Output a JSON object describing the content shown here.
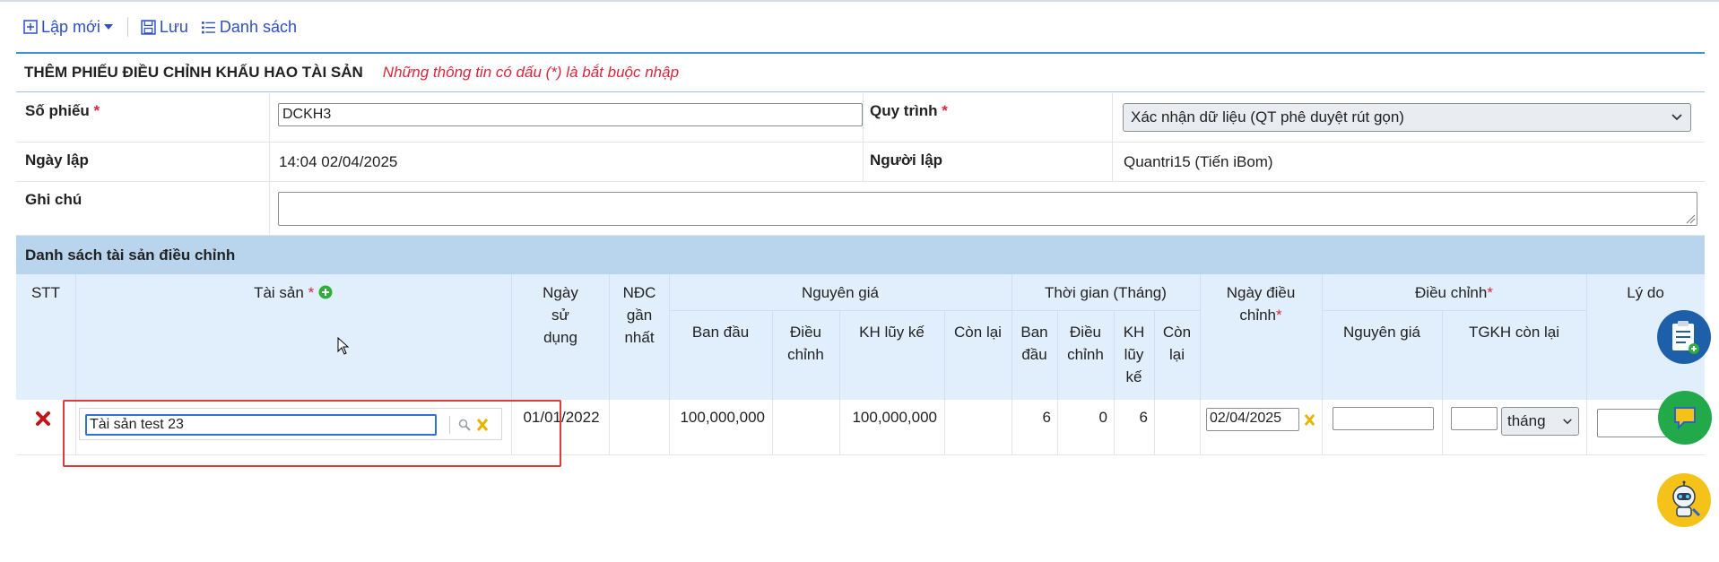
{
  "toolbar": {
    "new_label": "Lập mới",
    "save_label": "Lưu",
    "list_label": "Danh sách"
  },
  "form": {
    "title": "THÊM PHIẾU ĐIỀU CHỈNH KHẤU HAO TÀI SẢN",
    "note": "Những thông tin có dấu (*) là bắt buộc nhập",
    "so_phieu_label": "Số phiếu",
    "so_phieu_value": "DCKH3",
    "quy_trinh_label": "Quy trình",
    "quy_trinh_value": "Xác nhận dữ liệu (QT phê duyệt rút gọn)",
    "ngay_lap_label": "Ngày lập",
    "ngay_lap_value": "14:04 02/04/2025",
    "nguoi_lap_label": "Người lập",
    "nguoi_lap_value": "Quantri15 (Tiến iBom)",
    "ghi_chu_label": "Ghi chú",
    "ghi_chu_value": "",
    "required_mark": "*"
  },
  "list": {
    "title": "Danh sách tài sản điều chỉnh",
    "headers": {
      "stt": "STT",
      "tai_san": "Tài sản",
      "ngay_su_dung": "Ngày sử dụng",
      "ndc_gan_nhat": "NĐC gần nhất",
      "nguyen_gia": "Nguyên giá",
      "ban_dau": "Ban đầu",
      "dieu_chinh": "Điều chỉnh",
      "kh_luy_ke": "KH lũy kế",
      "con_lai": "Còn lại",
      "thoi_gian": "Thời gian (Tháng)",
      "tg_ban_dau": "Ban đầu",
      "tg_dieu_chinh": "Điều chỉnh",
      "tg_kh_luy_ke": "KH lũy kế",
      "tg_con_lai": "Còn lại",
      "ngay_dieu_chinh": "Ngày điều chỉnh",
      "dc_group": "Điều chỉnh",
      "dc_nguyen_gia": "Nguyên giá",
      "dc_tgkh_con_lai": "TGKH còn lại",
      "ly_do": "Lý do"
    },
    "rows": [
      {
        "tai_san": "Tài sản test 23",
        "ngay_su_dung": "01/01/2022",
        "ndc_gan_nhat": "",
        "ng_ban_dau": "100,000,000",
        "ng_dieu_chinh": "",
        "ng_kh_luy_ke": "100,000,000",
        "ng_con_lai": "",
        "tg_ban_dau": "6",
        "tg_dieu_chinh": "0",
        "tg_kh_luy_ke": "6",
        "tg_con_lai": "",
        "ngay_dieu_chinh": "02/04/2025",
        "dc_nguyen_gia": "",
        "dc_tgkh_value": "",
        "dc_tgkh_unit": "tháng",
        "ly_do": ""
      }
    ]
  },
  "colors": {
    "link": "#2d4fc9",
    "required": "#d7263d",
    "accent_line": "#3b8fd8",
    "list_header_bg": "#b9d5ee",
    "table_header_bg": "#e1eefc",
    "highlight": "#e03a3a"
  }
}
